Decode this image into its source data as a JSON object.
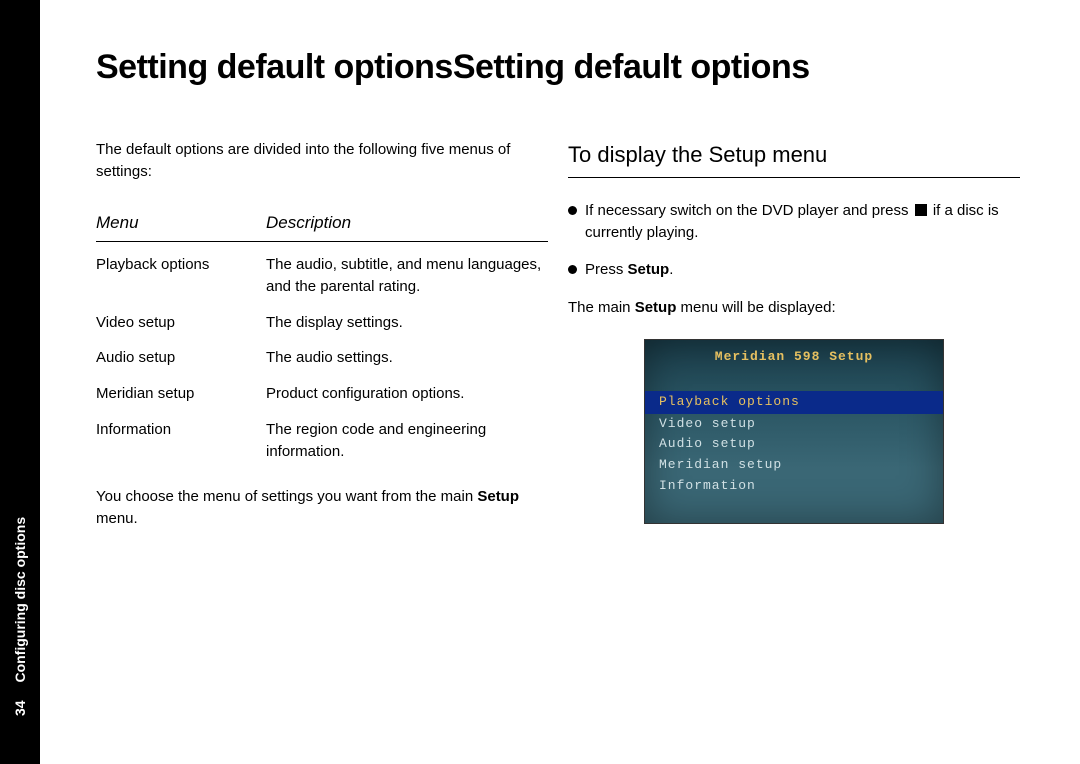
{
  "sidebar": {
    "page_number": "34",
    "section_label": "Configuring disc options"
  },
  "title": "Setting default options",
  "left": {
    "intro": "The default options are divided into the following five menus of settings:",
    "table_headers": {
      "menu": "Menu",
      "desc": "Description"
    },
    "rows": [
      {
        "menu": "Playback options",
        "desc": "The audio, subtitle, and menu languages, and the parental rating."
      },
      {
        "menu": "Video setup",
        "desc": "The display settings."
      },
      {
        "menu": "Audio setup",
        "desc": "The audio settings."
      },
      {
        "menu": "Meridian setup",
        "desc": "Product configuration options."
      },
      {
        "menu": "Information",
        "desc": "The region code and engineering information."
      }
    ],
    "closing_prefix": "You choose the menu of settings you want from the main ",
    "closing_bold": "Setup",
    "closing_suffix": " menu."
  },
  "right": {
    "heading": "To display the Setup menu",
    "bullet1_prefix": "If necessary switch on the DVD player and press ",
    "bullet1_suffix": " if a disc is currently playing.",
    "bullet2_prefix": "Press ",
    "bullet2_bold": "Setup",
    "bullet2_suffix": ".",
    "followup_prefix": "The main ",
    "followup_bold": "Setup",
    "followup_suffix": " menu will be displayed:",
    "screenshot": {
      "title": "Meridian 598 Setup",
      "items": [
        "Playback options",
        "Video setup",
        "Audio setup",
        "Meridian setup",
        "Information"
      ],
      "selected_index": 0
    }
  }
}
